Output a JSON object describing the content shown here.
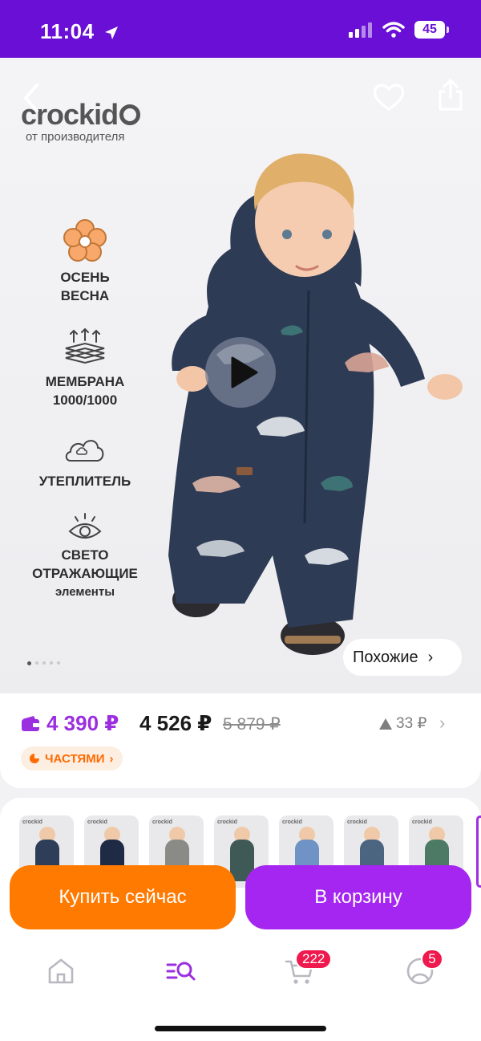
{
  "status_bar": {
    "time": "11:04",
    "battery": "45"
  },
  "brand": {
    "logo": "crockid",
    "subtitle": "от производителя"
  },
  "features": [
    {
      "icon": "flower-icon",
      "line1": "ОСЕНЬ",
      "line2": "ВЕСНА",
      "sub": ""
    },
    {
      "icon": "membrane-icon",
      "line1": "МЕМБРАНА",
      "line2": "1000/1000",
      "sub": ""
    },
    {
      "icon": "cloud-icon",
      "line1": "УТЕПЛИТЕЛЬ",
      "line2": "",
      "sub": ""
    },
    {
      "icon": "eye-icon",
      "line1": "СВЕТО",
      "line2": "ОТРАЖАЮЩИЕ",
      "sub": "элементы"
    }
  ],
  "hero": {
    "similar_label": "Похожие",
    "slides": 5,
    "active_slide": 0
  },
  "price": {
    "card_price": "4 390 ₽",
    "price": "4 526 ₽",
    "old_price": "5 879 ₽",
    "delta": "33 ₽",
    "installments": "ЧАСТЯМИ"
  },
  "thumbnails": [
    {
      "color": "#2f3e58"
    },
    {
      "color": "#1f2a44"
    },
    {
      "color": "#8a8a86"
    },
    {
      "color": "#3f5a56"
    },
    {
      "color": "#6f93c4"
    },
    {
      "color": "#4b6480"
    },
    {
      "color": "#4c7a64"
    }
  ],
  "actions": {
    "buy_now": "Купить сейчас",
    "add_to_cart": "В корзину"
  },
  "tab_bar": {
    "cart_badge": "222",
    "profile_badge": "5"
  },
  "colors": {
    "brand_purple": "#6a0fd6",
    "buy_orange": "#ff7a00",
    "cart_purple": "#a526f0",
    "card_price": "#9b2fe0",
    "badge": "#f0194e"
  }
}
